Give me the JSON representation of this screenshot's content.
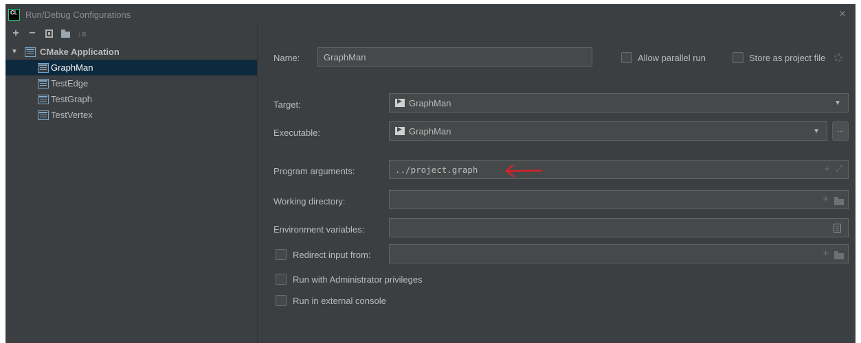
{
  "window": {
    "logo_text": "CL",
    "title": "Run/Debug Configurations",
    "close_glyph": "×"
  },
  "toolbar": {
    "add_glyph": "+",
    "remove_glyph": "−",
    "sort_glyph": "↓a"
  },
  "tree": {
    "group_label": "CMake Application",
    "items": [
      {
        "label": "GraphMan",
        "selected": true
      },
      {
        "label": "TestEdge"
      },
      {
        "label": "TestGraph"
      },
      {
        "label": "TestVertex"
      }
    ]
  },
  "form": {
    "name_label": "Name:",
    "name_value": "GraphMan",
    "allow_parallel_label": "Allow parallel run",
    "store_project_label": "Store as project file",
    "target_label": "Target:",
    "target_value": "GraphMan",
    "executable_label": "Executable:",
    "executable_value": "GraphMan",
    "browse_label": "...",
    "program_args_label": "Program arguments:",
    "program_args_value": "../project.graph",
    "working_dir_label": "Working directory:",
    "working_dir_value": "",
    "env_vars_label": "Environment variables:",
    "env_vars_value": "",
    "redirect_label": "Redirect input from:",
    "redirect_value": "",
    "admin_label": "Run with Administrator privileges",
    "external_console_label": "Run in external console",
    "plus_glyph": "+",
    "expand_glyph": "⤢"
  },
  "colors": {
    "background": "#3c3f41",
    "field": "#45494a",
    "selection": "#0d293e",
    "annotation_arrow": "#d9202a"
  }
}
